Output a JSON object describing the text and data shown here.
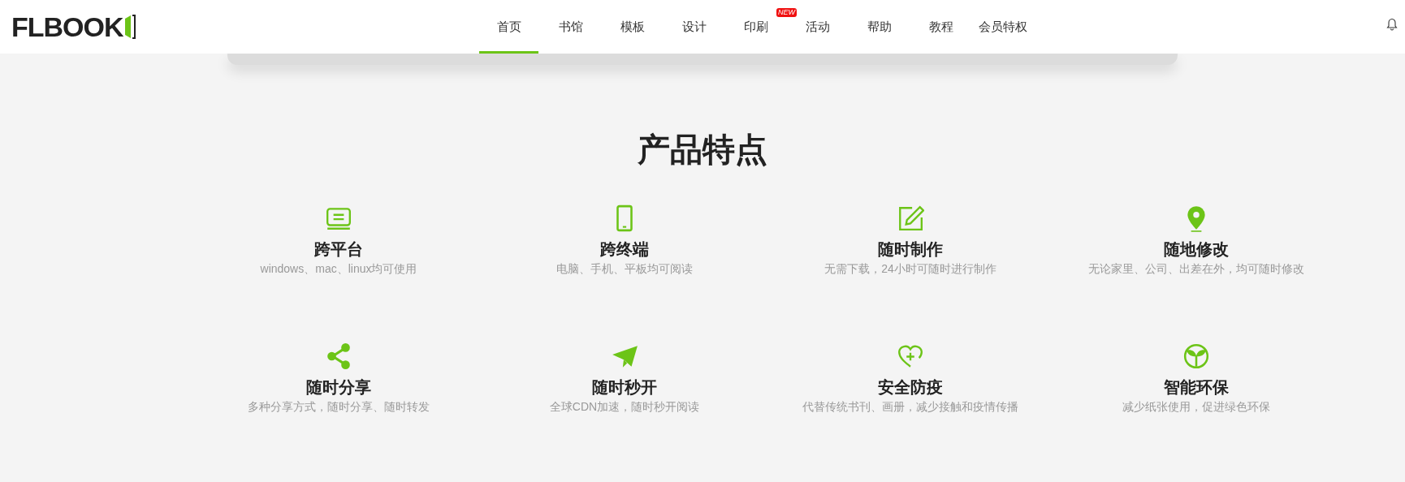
{
  "logo": "FLBOOK",
  "nav": [
    {
      "label": "首页",
      "selected": true
    },
    {
      "label": "书馆",
      "selected": false
    },
    {
      "label": "模板",
      "selected": false
    },
    {
      "label": "设计",
      "selected": false
    },
    {
      "label": "印刷",
      "selected": false,
      "badge": "NEW"
    },
    {
      "label": "活动",
      "selected": false
    },
    {
      "label": "帮助",
      "selected": false
    },
    {
      "label": "教程",
      "selected": false
    },
    {
      "label": "会员特权",
      "selected": false
    }
  ],
  "section_title": "产品特点",
  "features": [
    {
      "kind": "monitor",
      "title": "跨平台",
      "description": "windows、mac、linux均可使用"
    },
    {
      "kind": "phone",
      "title": "跨终端",
      "description": "电脑、手机、平板均可阅读"
    },
    {
      "kind": "edit",
      "title": "随时制作",
      "description": "无需下载，24小时可随时进行制作"
    },
    {
      "kind": "pin",
      "title": "随地修改",
      "description": "无论家里、公司、出差在外，均可随时修改"
    },
    {
      "kind": "share",
      "title": "随时分享",
      "description": "多种分享方式，随时分享、随时转发"
    },
    {
      "kind": "plane",
      "title": "随时秒开",
      "description": "全球CDN加速，随时秒开阅读"
    },
    {
      "kind": "heart",
      "title": "安全防疫",
      "description": "代替传统书刊、画册，减少接触和疫情传播"
    },
    {
      "kind": "sprout",
      "title": "智能环保",
      "description": "减少纸张使用，促进绿色环保"
    }
  ]
}
